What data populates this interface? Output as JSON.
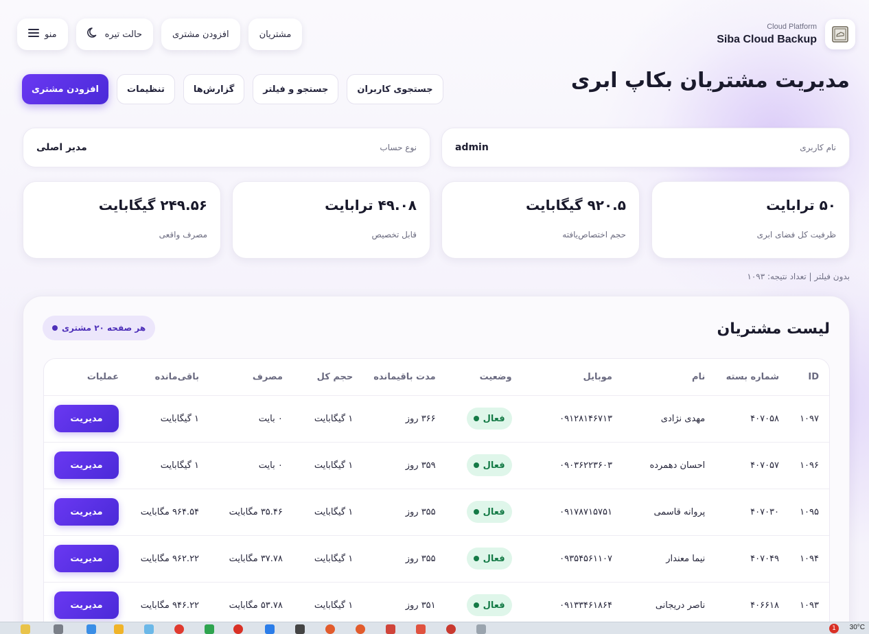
{
  "brand": {
    "subtitle": "Cloud Platform",
    "title": "Siba Cloud Backup",
    "logo_icon": "cloud-box-icon"
  },
  "topnav": {
    "customers": "مشتریان",
    "add_customer": "افزودن مشتری",
    "dark_mode": "حالت تیره",
    "menu": "منو"
  },
  "page_title": "مدیریت مشتریان بکاپ ابری",
  "actions": {
    "search_users": "جستجوی کاربران",
    "search_filter": "جستجو و فیلتر",
    "reports": "گزارش‌ها",
    "settings": "تنظیمات",
    "add_customer": "افزودن مشتری"
  },
  "info": {
    "username_label": "نام کاربری",
    "username_value": "admin",
    "account_type_label": "نوع حساب",
    "account_type_value": "مدیر اصلی"
  },
  "stats": [
    {
      "value": "۵۰ ترابایت",
      "label": "ظرفیت کل فضای ابری"
    },
    {
      "value": "۹۲۰.۵ گیگابایت",
      "label": "حجم اختصاص‌یافته"
    },
    {
      "value": "۴۹.۰۸ ترابایت",
      "label": "قابل تخصیص"
    },
    {
      "value": "۲۴۹.۵۶ گیگابایت",
      "label": "مصرف واقعی"
    }
  ],
  "filter_note": "بدون فیلتر | تعداد نتیجه: ۱۰۹۳",
  "list": {
    "title": "لیست مشتریان",
    "per_page": "هر صفحه ۲۰ مشتری",
    "columns": [
      "ID",
      "شماره بسته",
      "نام",
      "موبایل",
      "وضعیت",
      "مدت باقیمانده",
      "حجم کل",
      "مصرف",
      "باقی‌مانده",
      "عملیات"
    ],
    "rows": [
      {
        "id": "۱۰۹۷",
        "package": "۴۰۷۰۵۸",
        "name": "مهدی نژادی",
        "mobile": "۰۹۱۲۸۱۴۶۷۱۳",
        "status": "فعال",
        "remaining_days": "۳۶۶ روز",
        "total": "۱ گیگابایت",
        "used": "۰ بایت",
        "left": "۱ گیگابایت",
        "action": "مدیریت"
      },
      {
        "id": "۱۰۹۶",
        "package": "۴۰۷۰۵۷",
        "name": "احسان دهمرده",
        "mobile": "۰۹۰۳۶۲۲۳۶۰۳",
        "status": "فعال",
        "remaining_days": "۳۵۹ روز",
        "total": "۱ گیگابایت",
        "used": "۰ بایت",
        "left": "۱ گیگابایت",
        "action": "مدیریت"
      },
      {
        "id": "۱۰۹۵",
        "package": "۴۰۷۰۳۰",
        "name": "پروانه قاسمی",
        "mobile": "۰۹۱۷۸۷۱۵۷۵۱",
        "status": "فعال",
        "remaining_days": "۳۵۵ روز",
        "total": "۱ گیگابایت",
        "used": "۳۵.۴۶ مگابایت",
        "left": "۹۶۴.۵۴ مگابایت",
        "action": "مدیریت"
      },
      {
        "id": "۱۰۹۴",
        "package": "۴۰۷۰۴۹",
        "name": "نیما معندار",
        "mobile": "۰۹۳۵۴۵۶۱۱۰۷",
        "status": "فعال",
        "remaining_days": "۳۵۵ روز",
        "total": "۱ گیگابایت",
        "used": "۳۷.۷۸ مگابایت",
        "left": "۹۶۲.۲۲ مگابایت",
        "action": "مدیریت"
      },
      {
        "id": "۱۰۹۳",
        "package": "۴۰۶۶۱۸",
        "name": "ناصر دریجانی",
        "mobile": "۰۹۱۳۳۴۶۱۸۶۴",
        "status": "فعال",
        "remaining_days": "۳۵۱ روز",
        "total": "۱ گیگابایت",
        "used": "۵۳.۷۸ مگابایت",
        "left": "۹۴۶.۲۲ مگابایت",
        "action": "مدیریت"
      }
    ]
  },
  "taskbar": {
    "temperature": "30°C",
    "notification_count": "1"
  },
  "colors": {
    "accent": "#5a30e6",
    "status_active_bg": "#dff6ea",
    "status_active_text": "#147a46"
  }
}
